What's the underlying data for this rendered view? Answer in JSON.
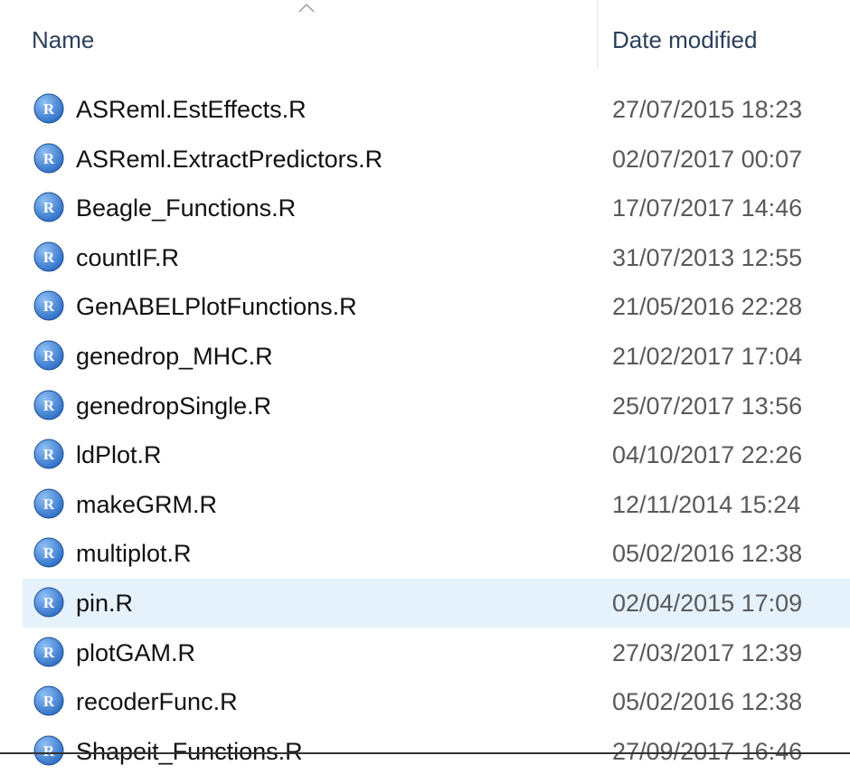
{
  "header": {
    "name_label": "Name",
    "date_label": "Date modified",
    "sort_indicator": "sort-ascending-chevron"
  },
  "icon": {
    "name": "r-file-icon",
    "glyph": "R",
    "color": "#2b6cc4"
  },
  "selection_color": "#e5f1fb",
  "files": [
    {
      "name": "ASReml.EstEffects.R",
      "date": "27/07/2015 18:23"
    },
    {
      "name": "ASReml.ExtractPredictors.R",
      "date": "02/07/2017 00:07"
    },
    {
      "name": "Beagle_Functions.R",
      "date": "17/07/2017 14:46"
    },
    {
      "name": "countIF.R",
      "date": "31/07/2013 12:55"
    },
    {
      "name": "GenABELPlotFunctions.R",
      "date": "21/05/2016 22:28"
    },
    {
      "name": "genedrop_MHC.R",
      "date": "21/02/2017 17:04"
    },
    {
      "name": "genedropSingle.R",
      "date": "25/07/2017 13:56"
    },
    {
      "name": "ldPlot.R",
      "date": "04/10/2017 22:26"
    },
    {
      "name": "makeGRM.R",
      "date": "12/11/2014 15:24"
    },
    {
      "name": "multiplot.R",
      "date": "05/02/2016 12:38"
    },
    {
      "name": "pin.R",
      "date": "02/04/2015 17:09",
      "selected": true
    },
    {
      "name": "plotGAM.R",
      "date": "27/03/2017 12:39"
    },
    {
      "name": "recoderFunc.R",
      "date": "05/02/2016 12:38"
    },
    {
      "name": "Shapeit_Functions.R",
      "date": "27/09/2017 16:46"
    }
  ]
}
